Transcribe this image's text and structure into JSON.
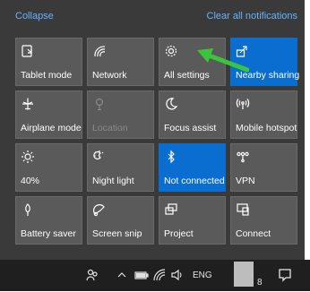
{
  "panel": {
    "collapse_label": "Collapse",
    "clear_label": "Clear all notifications"
  },
  "tiles": [
    {
      "label": "Tablet mode",
      "icon": "tablet-mode-icon",
      "state": "off"
    },
    {
      "label": "Network",
      "icon": "network-icon",
      "state": "off"
    },
    {
      "label": "All settings",
      "icon": "gear-icon",
      "state": "off"
    },
    {
      "label": "Nearby sharing",
      "icon": "nearby-sharing-icon",
      "state": "on"
    },
    {
      "label": "Airplane mode",
      "icon": "airplane-icon",
      "state": "off"
    },
    {
      "label": "Location",
      "icon": "location-icon",
      "state": "disabled"
    },
    {
      "label": "Focus assist",
      "icon": "moon-icon",
      "state": "off"
    },
    {
      "label": "Mobile hotspot",
      "icon": "hotspot-icon",
      "state": "off"
    },
    {
      "label": "40%",
      "icon": "brightness-icon",
      "state": "off"
    },
    {
      "label": "Night light",
      "icon": "night-light-icon",
      "state": "off"
    },
    {
      "label": "Not connected",
      "icon": "bluetooth-icon",
      "state": "on"
    },
    {
      "label": "VPN",
      "icon": "vpn-icon",
      "state": "off"
    },
    {
      "label": "Battery saver",
      "icon": "battery-saver-icon",
      "state": "off"
    },
    {
      "label": "Screen snip",
      "icon": "screen-snip-icon",
      "state": "off"
    },
    {
      "label": "Project",
      "icon": "project-icon",
      "state": "off"
    },
    {
      "label": "Connect",
      "icon": "connect-icon",
      "state": "off"
    }
  ],
  "taskbar": {
    "language": "ENG",
    "clock_fragment": "8"
  },
  "colors": {
    "accent": "#0a6ed1",
    "tile": "#5a5a5a",
    "panel": "#3a3a3a",
    "link": "#66b2ff",
    "annotation_arrow": "#3cc43c"
  }
}
